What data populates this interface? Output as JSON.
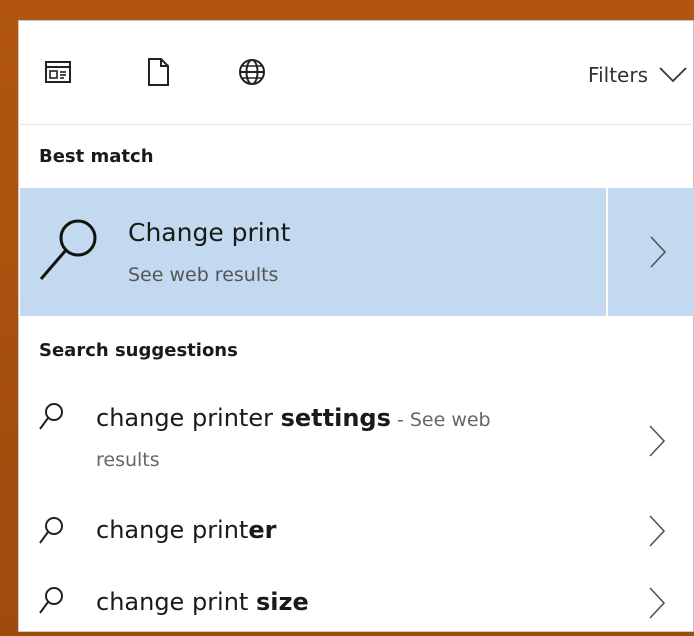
{
  "toolbar": {
    "filters_label": "Filters",
    "icons": [
      "apps-icon",
      "documents-icon",
      "web-icon",
      "chevron-down-icon"
    ]
  },
  "best_match": {
    "section_label": "Best match",
    "title": "Change print",
    "subtitle": "See web results"
  },
  "suggestions": {
    "section_label": "Search suggestions",
    "items": [
      {
        "prefix": "change print",
        "rest_plain": "er ",
        "bold": "settings",
        "hint": " - See web",
        "hint2": "results"
      },
      {
        "prefix": "change print",
        "bold": "er"
      },
      {
        "prefix": "change print ",
        "bold": "size"
      }
    ]
  },
  "colors": {
    "frame": "#a8500e",
    "highlight": "#c2d9ef",
    "text": "#1a1a1a"
  }
}
